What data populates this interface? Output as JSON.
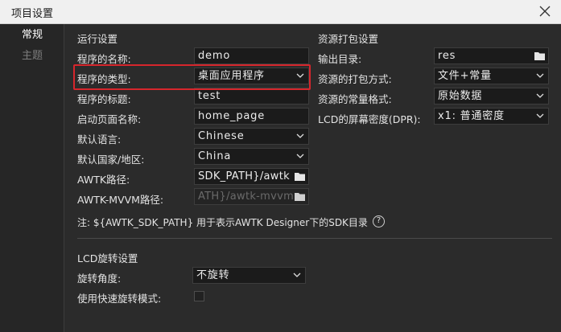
{
  "window": {
    "title": "项目设置"
  },
  "sidebar": {
    "items": [
      {
        "label": "常规",
        "active": true
      },
      {
        "label": "主题",
        "active": false
      }
    ]
  },
  "run": {
    "section_title": "运行设置",
    "app_name_label": "程序的名称:",
    "app_name_value": "demo",
    "app_type_label": "程序的类型:",
    "app_type_value": "桌面应用程序",
    "app_title_label": "程序的标题:",
    "app_title_value": "test",
    "start_page_label": "启动页面名称:",
    "start_page_value": "home_page",
    "language_label": "默认语言:",
    "language_value": "Chinese",
    "country_label": "默认国家/地区:",
    "country_value": "China",
    "awtk_path_label": "AWTK路径:",
    "awtk_path_value": "SDK_PATH}/awtk",
    "mvvm_path_label": "AWTK-MVVM路径:",
    "mvvm_path_value": "ATH}/awtk-mvvm",
    "note": "注: ${AWTK_SDK_PATH} 用于表示AWTK Designer下的SDK目录",
    "help_glyph": "?"
  },
  "res": {
    "section_title": "资源打包设置",
    "output_label": "输出目录:",
    "output_value": "res",
    "pack_mode_label": "资源的打包方式:",
    "pack_mode_value": "文件+常量",
    "const_format_label": "资源的常量格式:",
    "const_format_value": "原始数据",
    "dpr_label": "LCD的屏幕密度(DPR):",
    "dpr_value": "x1: 普通密度"
  },
  "lcd": {
    "section_title": "LCD旋转设置",
    "rotate_label": "旋转角度:",
    "rotate_value": "不旋转",
    "fast_rotate_label": "使用快速旋转模式:",
    "fast_rotate_checked": false
  },
  "colors": {
    "highlight": "#d6262c",
    "background": "#2b2b2b",
    "field": "#1b1b1b"
  },
  "icons": [
    "close-icon",
    "chevron-down-icon",
    "folder-icon",
    "help-icon"
  ]
}
